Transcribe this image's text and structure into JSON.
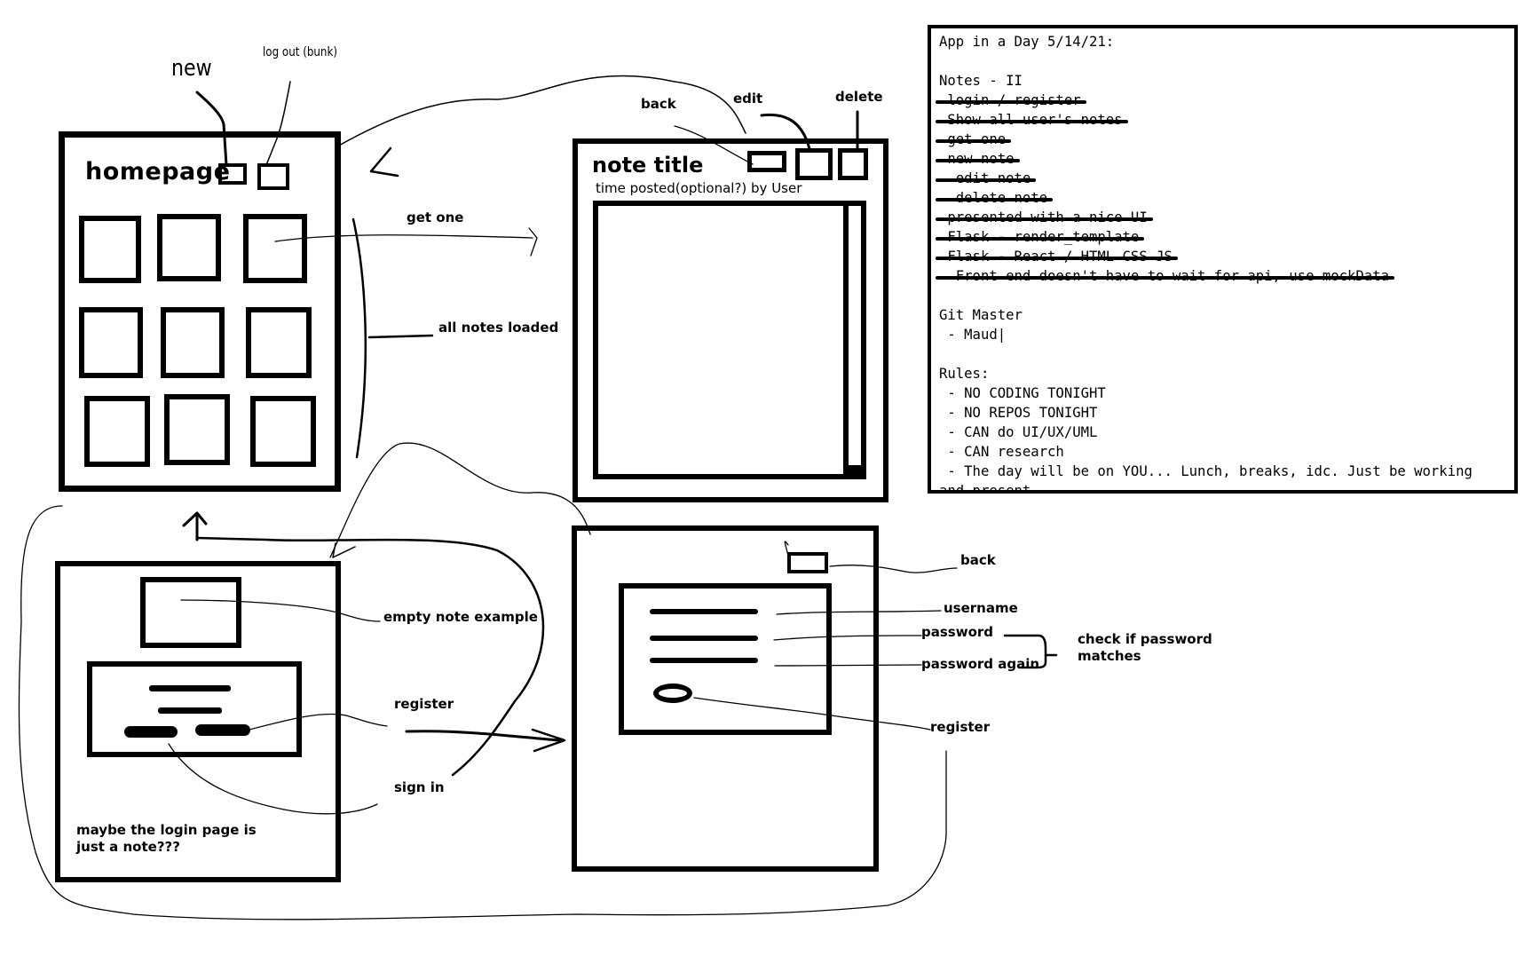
{
  "homepage": {
    "title": "homepage",
    "new_label": "new",
    "logout_label": "log out (bunk)",
    "get_one_label": "get one",
    "all_notes_label": "all notes loaded"
  },
  "note_view": {
    "title": "note title",
    "subtitle": "time posted(optional?) by User",
    "back_label": "back",
    "edit_label": "edit",
    "delete_label": "delete"
  },
  "login_page": {
    "empty_note_label": "empty note example",
    "register_label": "register",
    "sign_in_label": "sign in",
    "caption_line1": "maybe the login page is",
    "caption_line2": "just a note???"
  },
  "register_page": {
    "back_label": "back",
    "username_label": "username",
    "password_label": "password",
    "password_again_label": "password again",
    "check_line1": "check if password",
    "check_line2": "matches",
    "register_label": "register"
  },
  "notes_panel": {
    "lines": [
      {
        "text": "App in a Day 5/14/21:",
        "struck": false
      },
      {
        "text": "",
        "struck": false
      },
      {
        "text": "Notes - II",
        "struck": false
      },
      {
        "text": " login / register",
        "struck": true
      },
      {
        "text": " Show all user's notes",
        "struck": true
      },
      {
        "text": " get one",
        "struck": true
      },
      {
        "text": " new note",
        "struck": true
      },
      {
        "text": "  edit note",
        "struck": true
      },
      {
        "text": "  delete note",
        "struck": true
      },
      {
        "text": " presented with a nice UI",
        "struck": true
      },
      {
        "text": " Flask - render_template",
        "struck": true
      },
      {
        "text": " Flask - React / HTML CSS JS",
        "struck": true
      },
      {
        "text": "  Front end doesn't have to wait for api, use mockData",
        "struck": true
      },
      {
        "text": "",
        "struck": false
      },
      {
        "text": "Git Master",
        "struck": false
      },
      {
        "text": " - Maud|",
        "struck": false
      },
      {
        "text": "",
        "struck": false
      },
      {
        "text": "Rules:",
        "struck": false
      },
      {
        "text": " - NO CODING TONIGHT",
        "struck": false
      },
      {
        "text": " - NO REPOS TONIGHT",
        "struck": false
      },
      {
        "text": " - CAN do UI/UX/UML",
        "struck": false
      },
      {
        "text": " - CAN research",
        "struck": false
      },
      {
        "text": " - The day will be on YOU... Lunch, breaks, idc. Just be working",
        "struck": false
      },
      {
        "text": "and present",
        "struck": false
      }
    ]
  }
}
